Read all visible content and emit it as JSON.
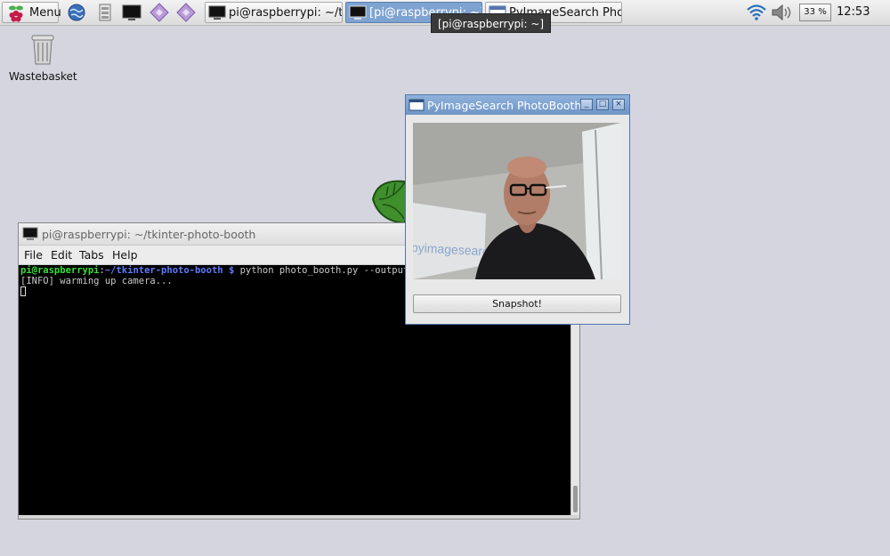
{
  "taskbar": {
    "menu_label": "Menu",
    "launchers": [
      "web-browser",
      "file-manager",
      "terminal",
      "mathematica",
      "wolfram"
    ],
    "tasks": [
      {
        "label": "pi@raspberrypi: ~/tki...",
        "active": false
      },
      {
        "label": "[pi@raspberrypi: ~]",
        "active": true
      },
      {
        "label": "PyImageSearch Phot...",
        "active": false
      }
    ],
    "tooltip": "[pi@raspberrypi: ~]",
    "cpu_usage": "33 %",
    "clock": "12:53"
  },
  "desktop": {
    "icons": [
      {
        "label": "Wastebasket",
        "icon": "trash-icon"
      }
    ]
  },
  "terminal": {
    "title": "pi@raspberrypi: ~/tkinter-photo-booth",
    "menu": [
      "File",
      "Edit",
      "Tabs",
      "Help"
    ],
    "prompt_user": "pi@raspberrypi",
    "prompt_sep": ":",
    "prompt_path": "~/tkinter-photo-booth",
    "prompt_dollar": "$",
    "command": " python photo_booth.py --output",
    "output": [
      "[INFO] warming up camera..."
    ]
  },
  "photobooth": {
    "title": "PyImageSearch PhotoBooth",
    "controls": [
      "_",
      "□",
      "×"
    ],
    "snapshot_label": "Snapshot!",
    "photo_text": "pyimagesearch"
  },
  "colors": {
    "desktop_bg": "#d5d5e0",
    "active_task": "#7fa3d0",
    "window_titlebar": "#7fa3d0",
    "prompt_user": "#35e035",
    "prompt_path": "#5c7cff"
  }
}
